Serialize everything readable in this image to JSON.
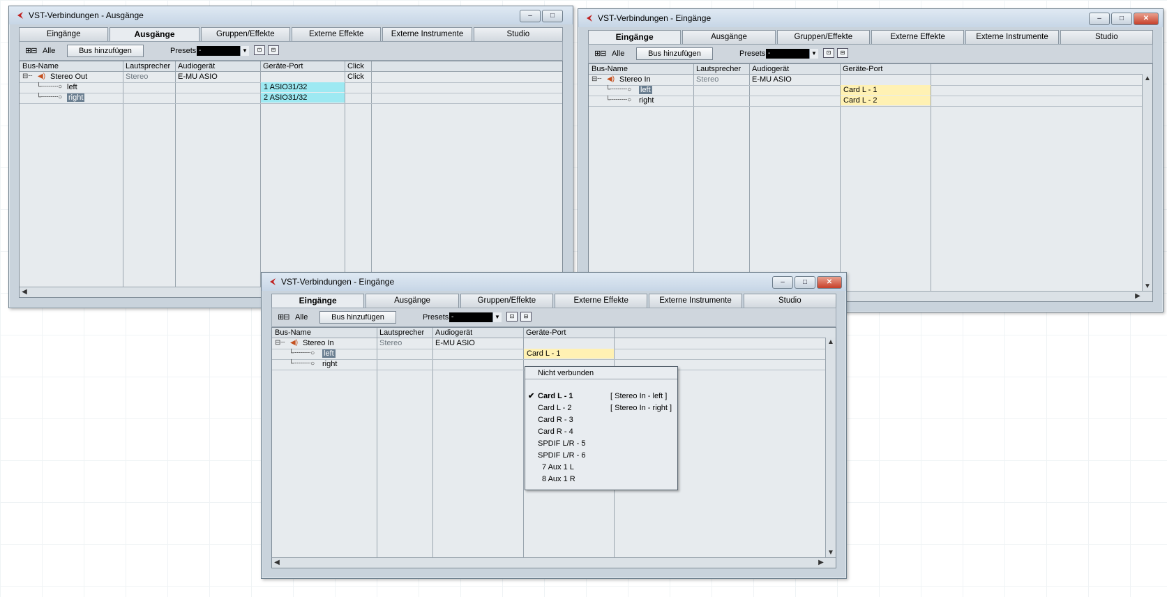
{
  "window_left": {
    "title": "VST-Verbindungen - Ausgänge",
    "tabs": [
      "Eingänge",
      "Ausgänge",
      "Gruppen/Effekte",
      "Externe Effekte",
      "Externe Instrumente",
      "Studio"
    ],
    "active_tab": "Ausgänge",
    "toolbar": {
      "all_label": "Alle",
      "add_bus_label": "Bus hinzufügen",
      "presets_label": "Presets",
      "presets_value": "-"
    },
    "columns": [
      "Bus-Name",
      "Lautsprecher",
      "Audiogerät",
      "Geräte-Port",
      "Click"
    ],
    "rows": [
      {
        "name": "Stereo Out",
        "speaker": "Stereo",
        "device": "E-MU ASIO",
        "port": "",
        "click": "Click"
      },
      {
        "name": "left",
        "speaker": "",
        "device": "",
        "port": "1 ASIO31/32",
        "click": ""
      },
      {
        "name": "right",
        "speaker": "",
        "device": "",
        "port": "2 ASIO31/32",
        "click": ""
      }
    ]
  },
  "window_right": {
    "title": "VST-Verbindungen - Eingänge",
    "tabs": [
      "Eingänge",
      "Ausgänge",
      "Gruppen/Effekte",
      "Externe Effekte",
      "Externe Instrumente",
      "Studio"
    ],
    "active_tab": "Eingänge",
    "toolbar": {
      "all_label": "Alle",
      "add_bus_label": "Bus hinzufügen",
      "presets_label": "Presets",
      "presets_value": "-"
    },
    "columns": [
      "Bus-Name",
      "Lautsprecher",
      "Audiogerät",
      "Geräte-Port"
    ],
    "rows": [
      {
        "name": "Stereo In",
        "speaker": "Stereo",
        "device": "E-MU ASIO",
        "port": ""
      },
      {
        "name": "left",
        "speaker": "",
        "device": "",
        "port": "Card L - 1"
      },
      {
        "name": "right",
        "speaker": "",
        "device": "",
        "port": "Card L - 2"
      }
    ]
  },
  "window_front": {
    "title": "VST-Verbindungen - Eingänge",
    "tabs": [
      "Eingänge",
      "Ausgänge",
      "Gruppen/Effekte",
      "Externe Effekte",
      "Externe Instrumente",
      "Studio"
    ],
    "active_tab": "Eingänge",
    "toolbar": {
      "all_label": "Alle",
      "add_bus_label": "Bus hinzufügen",
      "presets_label": "Presets",
      "presets_value": "-"
    },
    "columns": [
      "Bus-Name",
      "Lautsprecher",
      "Audiogerät",
      "Geräte-Port"
    ],
    "rows": [
      {
        "name": "Stereo In",
        "speaker": "Stereo",
        "device": "E-MU ASIO",
        "port": ""
      },
      {
        "name": "left",
        "speaker": "",
        "device": "",
        "port": "Card L - 1"
      },
      {
        "name": "right",
        "speaker": "",
        "device": "",
        "port": ""
      }
    ]
  },
  "port_menu": {
    "not_connected": "Nicht verbunden",
    "items": [
      {
        "label": "Card L - 1",
        "assigned": "[ Stereo In - left ]",
        "checked": true
      },
      {
        "label": "Card L - 2",
        "assigned": "[ Stereo In - right ]",
        "checked": false
      },
      {
        "label": "Card R - 3",
        "assigned": "",
        "checked": false
      },
      {
        "label": "Card R - 4",
        "assigned": "",
        "checked": false
      },
      {
        "label": "SPDIF L/R - 5",
        "assigned": "",
        "checked": false
      },
      {
        "label": "SPDIF L/R - 6",
        "assigned": "",
        "checked": false
      },
      {
        "label": "7 Aux 1 L",
        "assigned": "",
        "checked": false
      },
      {
        "label": "8 Aux 1 R",
        "assigned": "",
        "checked": false
      }
    ],
    "check_mark": "✔"
  },
  "titlebar_buttons": {
    "minimize": "–",
    "maximize": "□",
    "close": "✕"
  },
  "colors": {
    "port_cyan": "#9de9f2",
    "port_yellow": "#fff1b3",
    "selection": "#6a7e90",
    "close_red": "#c7402a"
  }
}
